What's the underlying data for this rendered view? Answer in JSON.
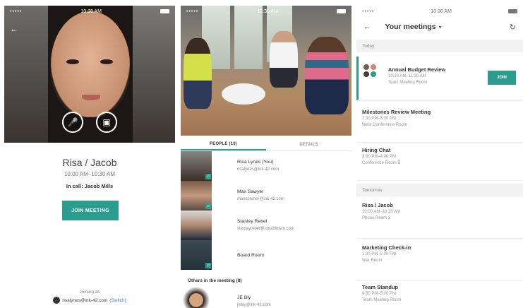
{
  "screen1": {
    "status_dots": "•••••",
    "status_time": "10:38 AM",
    "title": "Risa / Jacob",
    "time": "10:00 AM–10:30 AM",
    "in_call_label": "In call:",
    "in_call_name": "Jacob Mills",
    "join_label": "JOIN MEETING",
    "joining_as": "Joining as",
    "user_email": "risalynes@ink-42.com",
    "switch_label": "(Switch)"
  },
  "screen2": {
    "status_dots": "•••••",
    "status_time": "10:30 AM",
    "tab_people": "PEOPLE (10)",
    "tab_details": "DETAILS",
    "people": [
      {
        "name": "Risa Lynes (You)",
        "email": "risalynes@ink-42.com"
      },
      {
        "name": "Max Sawyer",
        "email": "maxsonmer@ink-42.com"
      },
      {
        "name": "Stanley Rebel",
        "email": "stanleyrebel@ronaldtown.com"
      },
      {
        "name": "Board Room",
        "email": ""
      }
    ],
    "others_label": "Others in the meeting (8)",
    "others_name": "JE Bly",
    "others_email": "jebly@ink-42.com"
  },
  "screen3": {
    "status_dots": "•••••",
    "status_time": "10:30 AM",
    "title": "Your meetings",
    "section_today": "Today",
    "section_tomorrow": "Tomorrow",
    "join_label": "JOIN",
    "today": [
      {
        "title": "Annual Budget Review",
        "time": "10:30 AM–11:30 AM",
        "place": "Team Meeting Room"
      },
      {
        "title": "Milestones Review Meeting",
        "time": "2:30 PM–3:30 PM",
        "place": "West Conference Room"
      },
      {
        "title": "Hiring Chat",
        "time": "3:30 PM–4:00 PM",
        "place": "Conference Room B"
      }
    ],
    "tomorrow": [
      {
        "title": "Risa / Jacob",
        "time": "10:00 AM–10:30 AM",
        "place": "Phone Room 3"
      },
      {
        "title": "Marketing Check-in",
        "time": "1:30 PM–2:30 PM",
        "place": "War Room"
      },
      {
        "title": "Team Standup",
        "time": "4:30 PM–5:00 PM",
        "place": "Team Meeting Room"
      }
    ]
  },
  "colors": {
    "accent": "#2a9d8f",
    "link": "#3a7bd5"
  },
  "icons": [
    "back-arrow-icon",
    "mic-off-icon",
    "video-off-icon",
    "dropdown-caret-icon",
    "refresh-icon",
    "mic-icon"
  ]
}
